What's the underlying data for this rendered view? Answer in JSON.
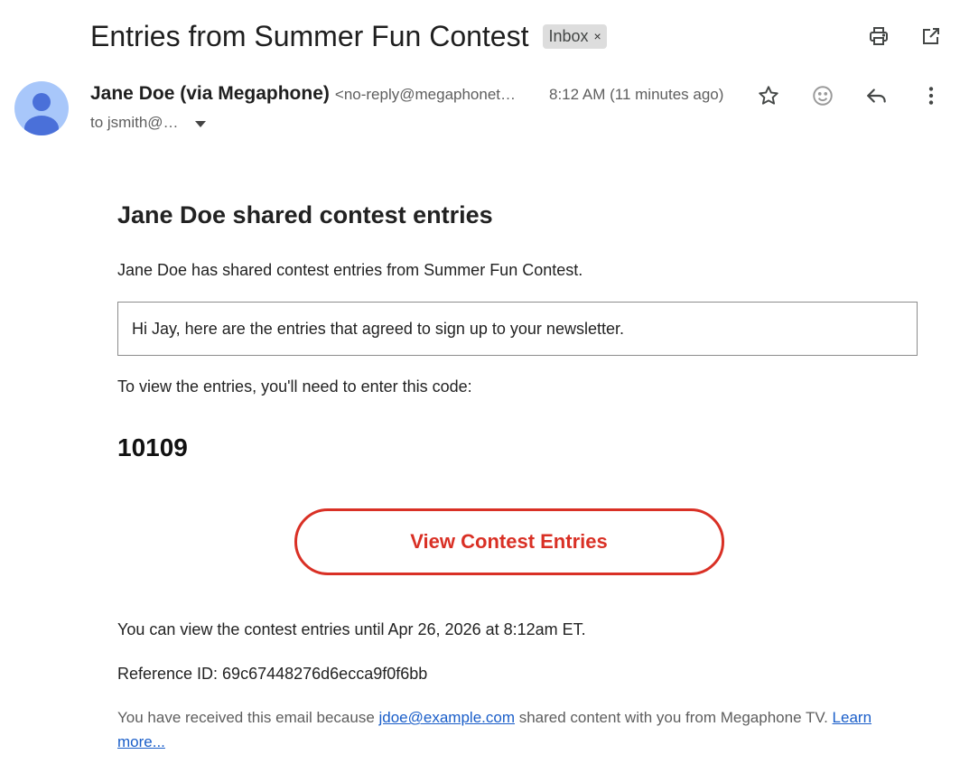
{
  "subject": {
    "title": "Entries from Summer Fun Contest",
    "label": "Inbox",
    "label_close": "×"
  },
  "toolbar_icons": [
    "print-icon",
    "open-in-new-window-icon"
  ],
  "sender": {
    "name": "Jane Doe (via Megaphone)",
    "email": "<no-reply@megaphonet…",
    "time": "8:12 AM (11 minutes ago)",
    "to": "to jsmith@…"
  },
  "message_actions": [
    "star-icon",
    "emoji-reaction-icon",
    "reply-icon",
    "more-options-icon"
  ],
  "body": {
    "heading": "Jane Doe shared contest entries",
    "intro": "Jane Doe has shared contest entries from Summer Fun Contest.",
    "note": "Hi Jay, here are the entries that agreed to sign up to your newsletter.",
    "code_prompt": "To view the entries, you'll need to enter this code:",
    "code": "10109",
    "cta_label": "View Contest Entries",
    "availability": "You can view the contest entries until Apr 26, 2026 at 8:12am ET.",
    "reference": "Reference ID: 69c67448276d6ecca9f0f6bb",
    "footer_prefix": "You have received this email because ",
    "footer_link": "jdoe@example.com",
    "footer_middle": " shared content with you from Megaphone TV. ",
    "footer_learn_more": "Learn more..."
  },
  "colors": {
    "cta": "#d93025",
    "avatar_bg": "#a8c7fa",
    "avatar_fg": "#4a70d9",
    "link": "#1a5ec9"
  }
}
